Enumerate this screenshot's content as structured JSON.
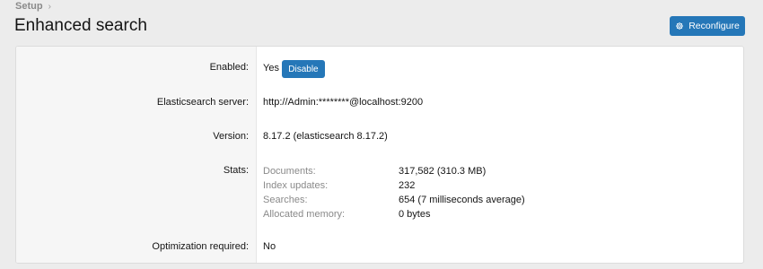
{
  "breadcrumb": {
    "items": [
      "Setup"
    ]
  },
  "header": {
    "title": "Enhanced search",
    "reconfigure_label": "Reconfigure"
  },
  "settings": {
    "enabled": {
      "label": "Enabled:",
      "value": "Yes",
      "button_label": "Disable"
    },
    "server": {
      "label": "Elasticsearch server:",
      "value": "http://Admin:********@localhost:9200"
    },
    "version": {
      "label": "Version:",
      "value": "8.17.2 (elasticsearch 8.17.2)"
    },
    "stats": {
      "label": "Stats:",
      "items": [
        {
          "name": "Documents:",
          "value": "317,582 (310.3 MB)"
        },
        {
          "name": "Index updates:",
          "value": "232"
        },
        {
          "name": "Searches:",
          "value": "654 (7 milliseconds average)"
        },
        {
          "name": "Allocated memory:",
          "value": "0 bytes"
        }
      ]
    },
    "optimization": {
      "label": "Optimization required:",
      "value": "No"
    }
  },
  "colors": {
    "accent": "#2577b8",
    "background": "#ececec",
    "label_column": "#f6f6f6",
    "muted_text": "#8a8a8a"
  },
  "icons": {
    "reconfigure": "gear-icon",
    "breadcrumb_separator": "chevron-right-icon"
  }
}
